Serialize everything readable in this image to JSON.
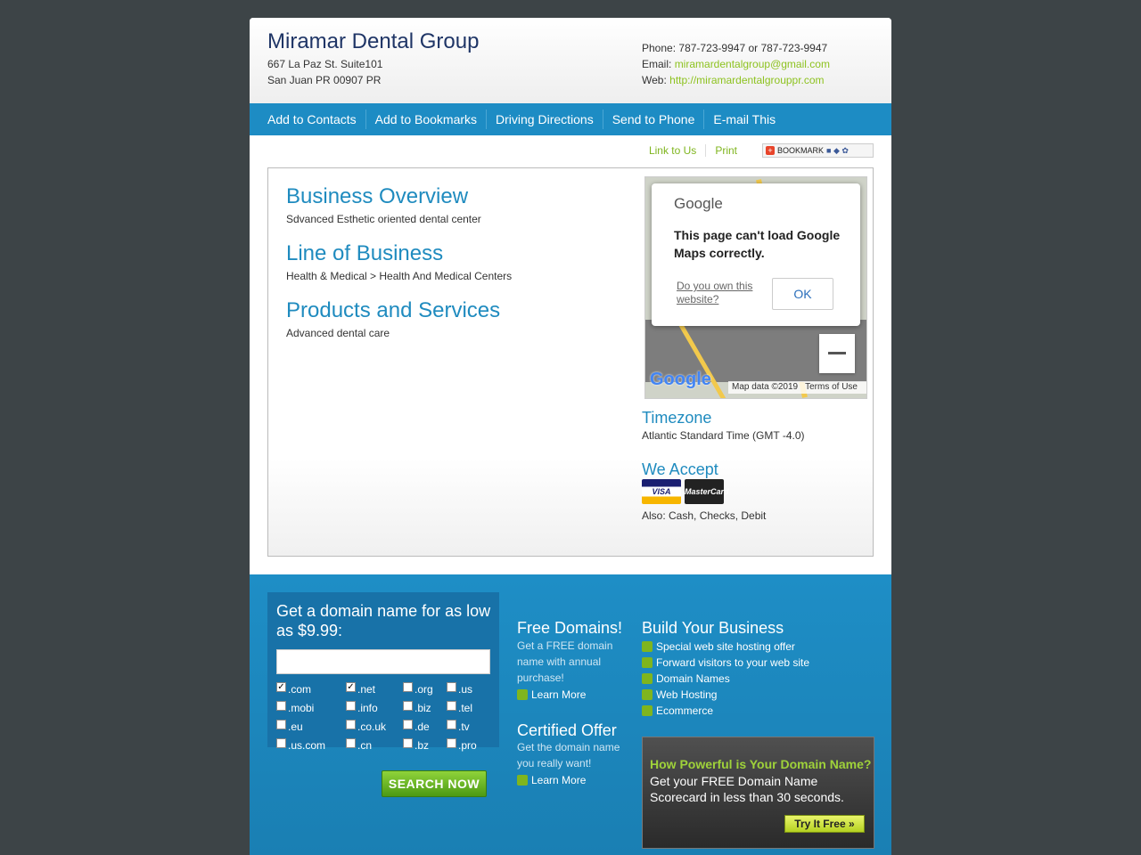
{
  "header": {
    "business_name": "Miramar Dental Group",
    "address_line1": "667 La Paz St. Suite101",
    "address_line2": "San Juan PR 00907 PR",
    "phone_label": "Phone:",
    "phone": "787-723-9947 or 787-723-9947",
    "email_label": "Email:",
    "email": "miramardentalgroup@gmail.com",
    "web_label": "Web:",
    "web": "http://miramardentalgrouppr.com"
  },
  "nav": {
    "items": [
      {
        "label": "Add to Contacts"
      },
      {
        "label": "Add to Bookmarks"
      },
      {
        "label": "Driving Directions"
      },
      {
        "label": "Send to Phone"
      },
      {
        "label": "E-mail This"
      }
    ]
  },
  "utility": {
    "link_to_us": "Link to Us",
    "print": "Print",
    "bookmark": "BOOKMARK"
  },
  "main": {
    "overview_title": "Business Overview",
    "overview_text": "Sdvanced Esthetic oriented dental center",
    "lob_title": "Line of Business",
    "lob_text": "Health & Medical > Health And Medical Centers",
    "products_title": "Products and Services",
    "products_text": "Advanced dental care"
  },
  "map": {
    "logo": "Google",
    "message": "This page can't load Google Maps correctly.",
    "own_link": "Do you own this website?",
    "ok": "OK",
    "map_data": "Map data ©2019",
    "terms": "Terms of Use",
    "google_mark": "Google"
  },
  "sidebar": {
    "timezone_title": "Timezone",
    "timezone_text": "Atlantic Standard Time (GMT -4.0)",
    "accept_title": "We Accept",
    "visa": "VISA",
    "mastercard": "MasterCard",
    "also": "Also: Cash, Checks, Debit"
  },
  "footer": {
    "domain_title": "Get a domain name for as low as $9.99:",
    "tlds": [
      {
        "label": ".com",
        "checked": true
      },
      {
        "label": ".net",
        "checked": true
      },
      {
        "label": ".org",
        "checked": false
      },
      {
        "label": ".us",
        "checked": false
      },
      {
        "label": ".mobi",
        "checked": false
      },
      {
        "label": ".info",
        "checked": false
      },
      {
        "label": ".biz",
        "checked": false
      },
      {
        "label": ".tel",
        "checked": false
      },
      {
        "label": ".eu",
        "checked": false
      },
      {
        "label": ".co.uk",
        "checked": false
      },
      {
        "label": ".de",
        "checked": false
      },
      {
        "label": ".tv",
        "checked": false
      },
      {
        "label": ".us.com",
        "checked": false
      },
      {
        "label": ".cn",
        "checked": false
      },
      {
        "label": ".bz",
        "checked": false
      },
      {
        "label": ".pro",
        "checked": false
      }
    ],
    "search_button": "SEARCH NOW",
    "free_title": "Free Domains!",
    "free_text": "Get a FREE domain name with annual purchase!",
    "learn_more": "Learn More",
    "cert_title": "Certified Offer",
    "cert_text": "Get the domain name you really want!",
    "build_title": "Build Your Business",
    "build_items": [
      "Special web site hosting offer",
      "Forward visitors to your web site",
      "Domain Names",
      "Web Hosting",
      "Ecommerce"
    ],
    "promo_heading": "How Powerful is Your Domain Name?",
    "promo_text": "Get your FREE Domain Name Scorecard in less than 30 seconds.",
    "promo_button": "Try It Free"
  }
}
